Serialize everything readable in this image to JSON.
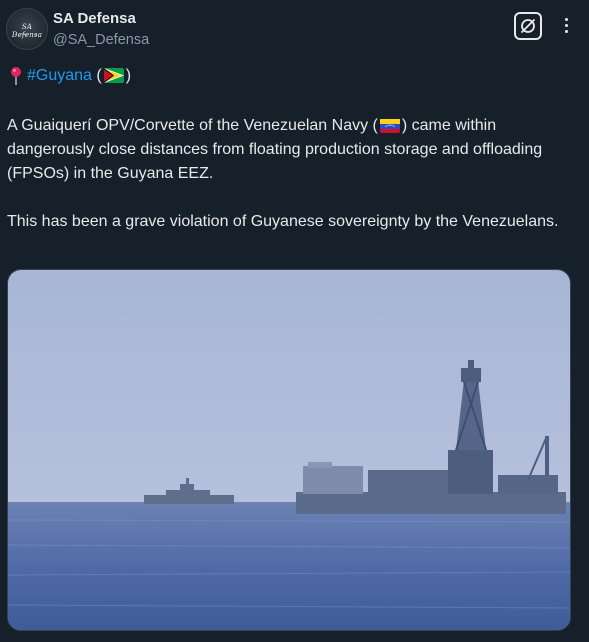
{
  "author": {
    "display_name": "SA Defensa",
    "handle": "@SA_Defensa",
    "avatar_text": "SA Defensa"
  },
  "post": {
    "hashtag": "#Guyana",
    "paren_open": "(",
    "paren_close": ")",
    "line1_before_flag": "A Guaiquerí OPV/Corvette of the Venezuelan Navy (",
    "line1_after_flag": ") came within dangerously close distances from floating production storage and offloading (FPSOs) in the Guyana EEZ.",
    "paragraph2": "This has been a grave violation of Guyanese sovereignty by the Venezuelans."
  },
  "icons": {
    "location": "round-pushpin-icon",
    "flag_guyana": "flag-guyana-icon",
    "flag_venezuela": "flag-venezuela-icon",
    "grok": "grok-icon",
    "more": "more-icon"
  },
  "colors": {
    "background": "#15202b",
    "text": "#e7e9ea",
    "secondary_text": "#8b98a5",
    "link": "#1d9bf0"
  }
}
